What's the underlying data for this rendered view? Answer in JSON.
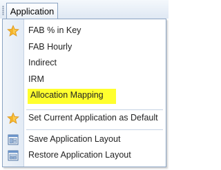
{
  "toolbar": {
    "application_label": "Application"
  },
  "menu": {
    "items": [
      {
        "label": "FAB % in Key",
        "icon": "star-icon"
      },
      {
        "label": "FAB Hourly",
        "icon": ""
      },
      {
        "label": "Indirect",
        "icon": ""
      },
      {
        "label": "IRM",
        "icon": ""
      },
      {
        "label": "Allocation Mapping",
        "icon": "",
        "highlighted": true
      },
      {
        "label": "Set Current Application as Default",
        "icon": "star-icon"
      },
      {
        "label": "Save Application Layout",
        "icon": "save-layout-icon"
      },
      {
        "label": "Restore Application Layout",
        "icon": "restore-layout-icon"
      }
    ]
  },
  "colors": {
    "highlight": "#ffff2e",
    "star": "#f5b52a",
    "border": "#8aa3c2"
  }
}
